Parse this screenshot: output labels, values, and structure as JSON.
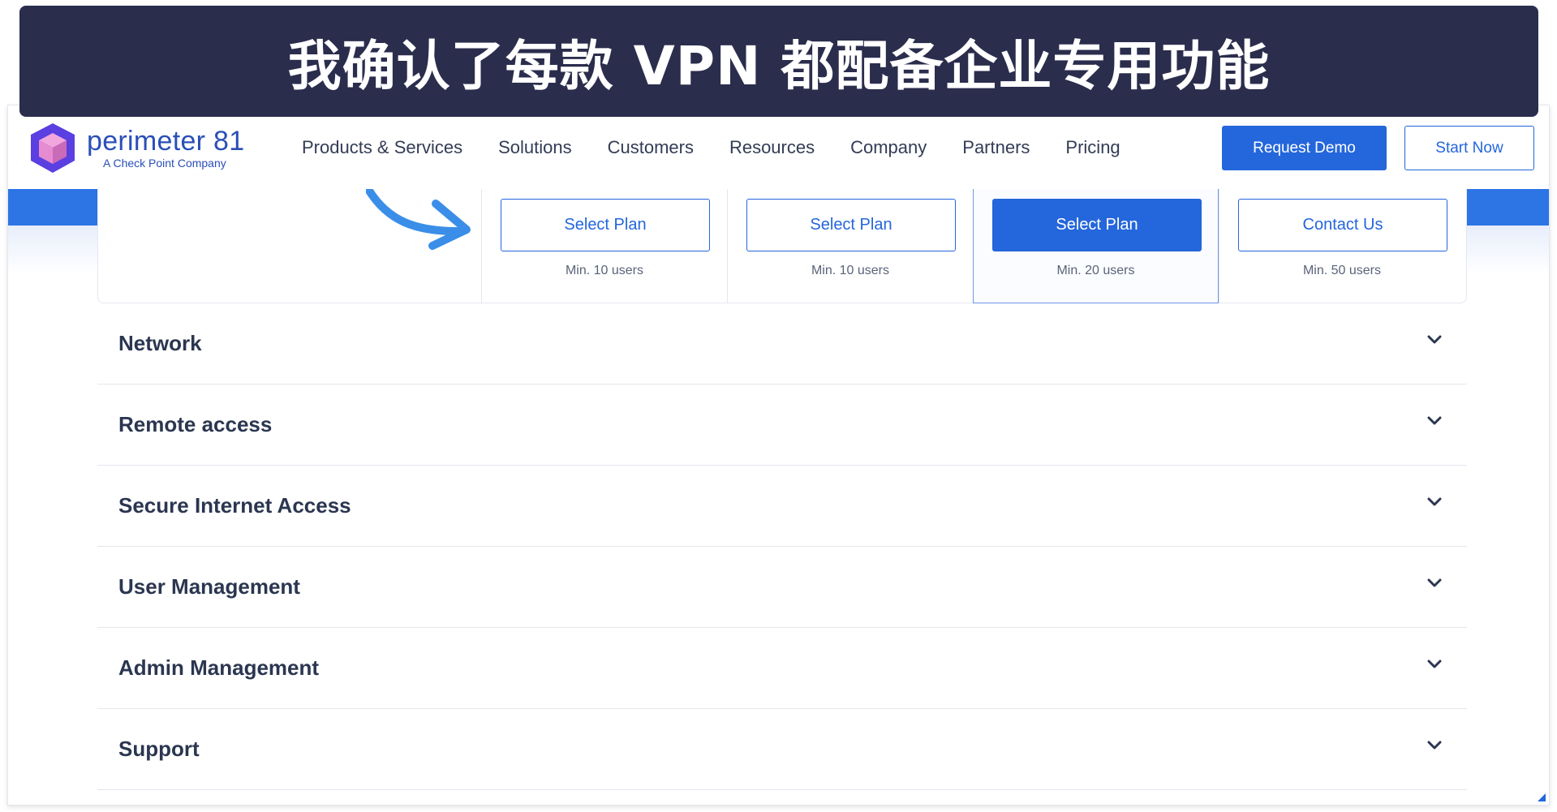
{
  "banner": {
    "title": "我确认了每款 VPN 都配备企业专用功能"
  },
  "brand": {
    "name": "perimeter 81",
    "subtitle": "A Check Point Company",
    "accent": "#2466dc",
    "logo_colors": [
      "#5b3fe0",
      "#e68bd0"
    ]
  },
  "nav": {
    "items": [
      {
        "label": "Products & Services"
      },
      {
        "label": "Solutions"
      },
      {
        "label": "Customers"
      },
      {
        "label": "Resources"
      },
      {
        "label": "Company"
      },
      {
        "label": "Partners"
      },
      {
        "label": "Pricing"
      }
    ],
    "request_demo": "Request Demo",
    "start_now": "Start Now"
  },
  "plans": [
    {
      "button": "Select Plan",
      "min": "Min. 10 users",
      "highlight": false
    },
    {
      "button": "Select Plan",
      "min": "Min. 10 users",
      "highlight": false
    },
    {
      "button": "Select Plan",
      "min": "Min. 20 users",
      "highlight": true
    },
    {
      "button": "Contact Us",
      "min": "Min. 50 users",
      "highlight": false
    }
  ],
  "sections": [
    {
      "label": "Network"
    },
    {
      "label": "Remote access"
    },
    {
      "label": "Secure Internet Access"
    },
    {
      "label": "User Management"
    },
    {
      "label": "Admin Management"
    },
    {
      "label": "Support"
    }
  ]
}
